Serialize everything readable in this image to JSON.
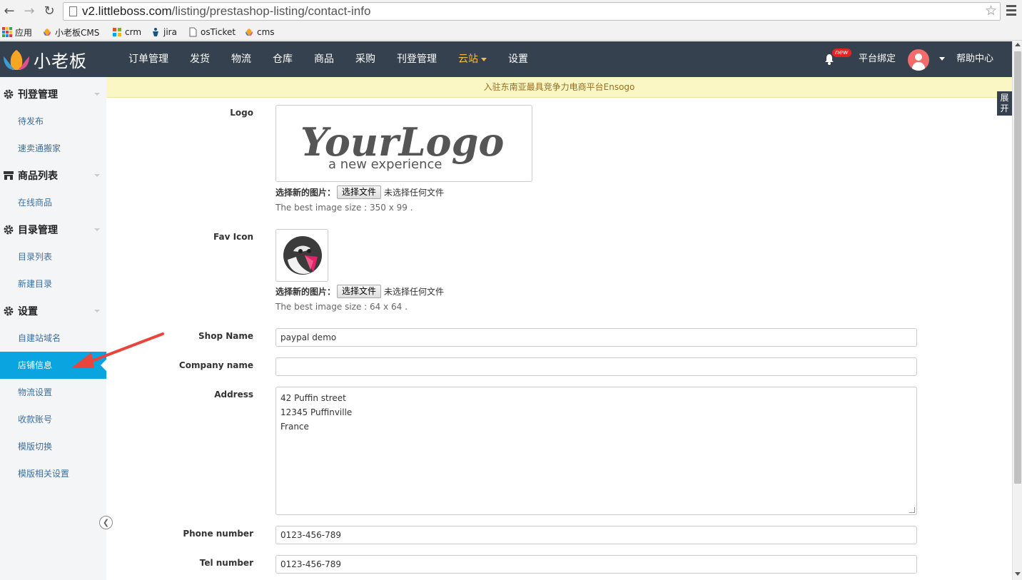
{
  "browser": {
    "url_host": "v2.littleboss.com",
    "url_path": "/listing/prestashop-listing/contact-info"
  },
  "bookmarks": [
    {
      "label": "应用",
      "icon": "apps-icon"
    },
    {
      "label": "小老板CMS",
      "icon": "littleboss-icon"
    },
    {
      "label": "crm",
      "icon": "windows-icon"
    },
    {
      "label": "jira",
      "icon": "jira-icon"
    },
    {
      "label": "osTicket",
      "icon": "page-icon"
    },
    {
      "label": "cms",
      "icon": "littleboss-icon"
    }
  ],
  "header": {
    "logo_text": "小老板",
    "nav": [
      "订单管理",
      "发货",
      "物流",
      "仓库",
      "商品",
      "采购",
      "刊登管理",
      "云站",
      "设置"
    ],
    "active_nav": "云站",
    "new_badge": "new",
    "platform_bind": "平台绑定",
    "help_center": "帮助中心",
    "accent_color": "#f6bd3e",
    "bg_color": "#36414f"
  },
  "sidebar": {
    "groups": [
      {
        "title": "刊登管理",
        "icon": "gear-icon",
        "items": [
          "待发布",
          "速卖通搬家"
        ]
      },
      {
        "title": "商品列表",
        "icon": "store-icon",
        "items": [
          "在线商品"
        ]
      },
      {
        "title": "目录管理",
        "icon": "gear-icon",
        "items": [
          "目录列表",
          "新建目录"
        ]
      },
      {
        "title": "设置",
        "icon": "gear-icon",
        "items": [
          "自建站域名",
          "店铺信息",
          "物流设置",
          "收款账号",
          "模版切换",
          "模版相关设置"
        ]
      }
    ],
    "active_item": "店铺信息",
    "active_color": "#0aa5e0"
  },
  "notice": "入驻东南亚最具竞争力电商平台Ensogo",
  "expand_tab": "展开",
  "form": {
    "logo": {
      "label": "Logo",
      "image_text_main": "YourLogo",
      "image_text_sub": "a new experience",
      "choose_label": "选择新的图片：",
      "button": "选择文件",
      "no_file": "未选择任何文件",
      "hint": "The best image size : 350 x 99 ."
    },
    "fav_icon": {
      "label": "Fav Icon",
      "choose_label": "选择新的图片：",
      "button": "选择文件",
      "no_file": "未选择任何文件",
      "hint": "The best image size : 64 x 64 ."
    },
    "shop_name": {
      "label": "Shop Name",
      "value": "paypal demo"
    },
    "company_name": {
      "label": "Company name",
      "value": ""
    },
    "address": {
      "label": "Address",
      "lines": [
        "42 Puffin street",
        "12345 Puffinville",
        "France"
      ]
    },
    "phone_number": {
      "label": "Phone number",
      "value": "0123-456-789"
    },
    "tel_number": {
      "label": "Tel number",
      "value": "0123-456-789"
    }
  }
}
